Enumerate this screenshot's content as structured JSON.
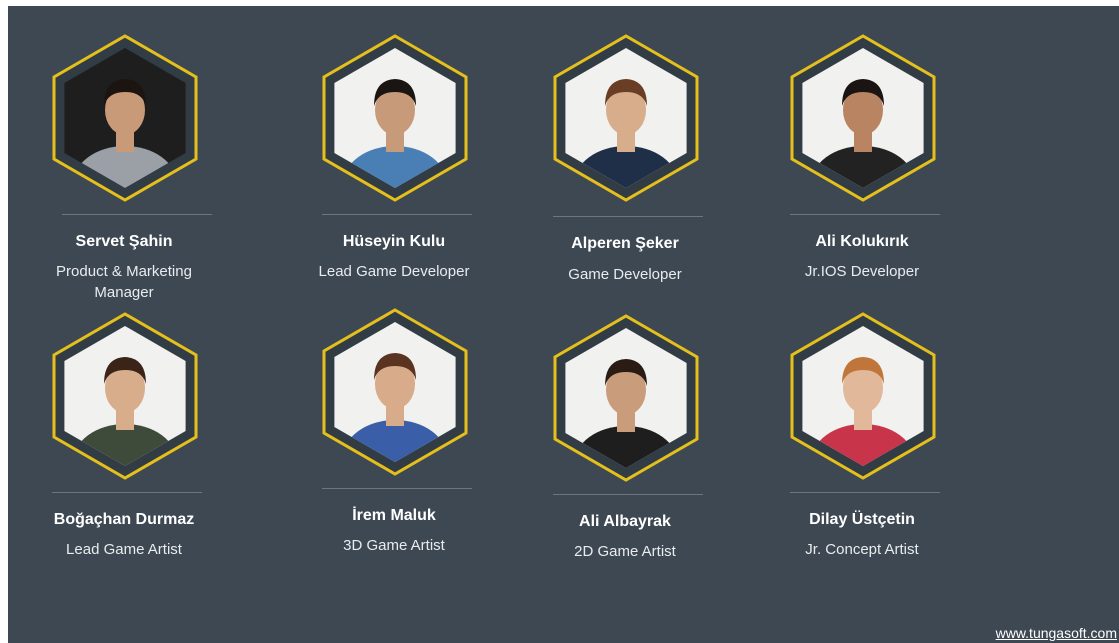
{
  "team": [
    {
      "name": "Servet Şahin",
      "role": "Product & Marketing Manager",
      "avatar": "person-photo-icon",
      "bg": "#1e1e1e",
      "shirt": "#9aa0a6",
      "skin": "#c89a78",
      "hair": "#1b1410"
    },
    {
      "name": "Hüseyin Kulu",
      "role": "Lead Game Developer",
      "avatar": "person-photo-icon",
      "bg": "#f1f1ef",
      "shirt": "#4a7fb5",
      "skin": "#c79b7a",
      "hair": "#1a1412"
    },
    {
      "name": "Alperen Şeker",
      "role": "Game Developer",
      "avatar": "person-photo-icon",
      "bg": "#f1f1ef",
      "shirt": "#1f2f48",
      "skin": "#d7ad8c",
      "hair": "#6a3e24"
    },
    {
      "name": "Ali Kolukırık",
      "role": "Jr.IOS Developer",
      "avatar": "person-photo-icon",
      "bg": "#f1f1ef",
      "shirt": "#222222",
      "skin": "#b98462",
      "hair": "#1a1412"
    },
    {
      "name": "Boğaçhan Durmaz",
      "role": "Lead Game Artist",
      "avatar": "person-photo-icon",
      "bg": "#f1f1ef",
      "shirt": "#3e4a3a",
      "skin": "#d8ad8c",
      "hair": "#3a2418"
    },
    {
      "name": "İrem Maluk",
      "role": "3D Game Artist",
      "avatar": "person-photo-icon",
      "bg": "#f1f1ef",
      "shirt": "#3a5fa8",
      "skin": "#d8ac8a",
      "hair": "#5a3420"
    },
    {
      "name": "Ali Albayrak",
      "role": "2D Game Artist",
      "avatar": "person-photo-icon",
      "bg": "#f1f1ef",
      "shirt": "#1e1e1e",
      "skin": "#c99c7c",
      "hair": "#2a1c14"
    },
    {
      "name": "Dilay Üstçetin",
      "role": "Jr. Concept Artist",
      "avatar": "person-photo-icon",
      "bg": "#f1f1ef",
      "shirt": "#c8354a",
      "skin": "#e2b89a",
      "hair": "#c0763a"
    }
  ],
  "colors": {
    "background": "#3d4852",
    "hex_border": "#e5c01c",
    "hex_inner": "#323c45",
    "text": "#ffffff"
  },
  "footer": {
    "link": "www.tungasoft.com"
  }
}
